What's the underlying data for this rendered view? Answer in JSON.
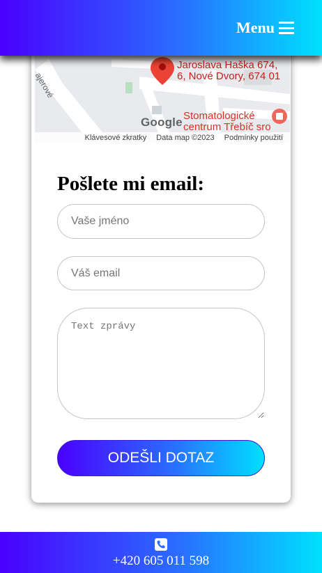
{
  "header": {
    "menu_label": "Menu",
    "menu_icon": "hamburger-icon"
  },
  "map": {
    "address_line1": "Jaroslava Haška 674,",
    "address_line2": "6, Nové Dvory, 674 01",
    "street_label": "ajerové",
    "poi_line1": "Stomatologické",
    "poi_line2": "centrum Třebíč sro",
    "google_logo": "Google",
    "footer": {
      "shortcuts": "Klávesové zkratky",
      "map_data": "Data map ©2023",
      "terms": "Podmínky použití"
    }
  },
  "form": {
    "title": "Pošlete mi email:",
    "name_placeholder": "Vaše jméno",
    "email_placeholder": "Váš email",
    "message_placeholder": "Text zprávy",
    "submit_label": "ODEŠLI DOTAZ"
  },
  "footer": {
    "phone_icon": "phone-icon",
    "phone": "+420 605 011 598"
  },
  "colors": {
    "gradient_start": "#4a00ff",
    "gradient_end": "#00e0ff",
    "map_pin": "#ea4335"
  }
}
